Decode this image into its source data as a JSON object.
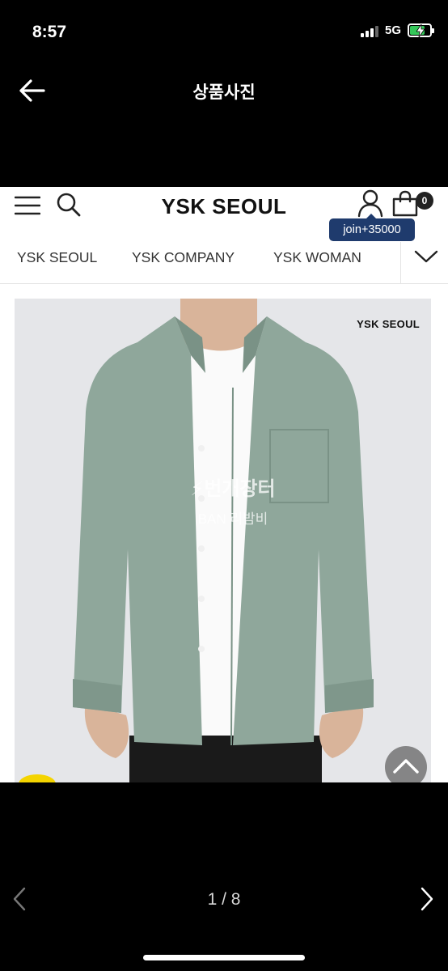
{
  "status_bar": {
    "time": "8:57",
    "network": "5G",
    "battery_level": 0.75,
    "battery_color": "#34c759",
    "charging": true
  },
  "title_bar": {
    "back_icon": "arrow-left-icon",
    "title": "상품사진"
  },
  "shop": {
    "logo": "YSK SEOUL",
    "cart_count": "0",
    "join_badge": "join+35000",
    "join_badge_color": "#1f3b6d",
    "categories": [
      "YSK SEOUL",
      "YSK COMPANY",
      "YSK WOMAN"
    ],
    "photo_brand": "YSK SEOUL",
    "watermark_main": "⚡번개장터",
    "watermark_sub": "BAN  리밤비",
    "shirt_color": "#8fa79b"
  },
  "pager": {
    "counter": "1 / 8"
  }
}
